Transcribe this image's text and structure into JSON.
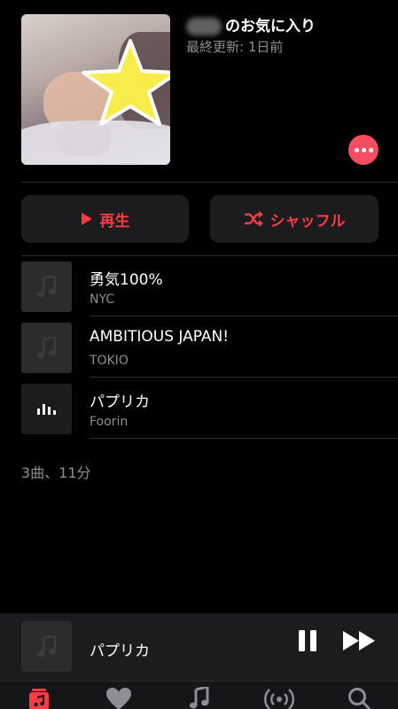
{
  "playlist": {
    "title_suffix": "のお気に入り",
    "updated": "最終更新: 1日前"
  },
  "actions": {
    "play_label": "再生",
    "shuffle_label": "シャッフル"
  },
  "songs": [
    {
      "title": "勇気100%",
      "artist": "NYC",
      "playing": false
    },
    {
      "title": "AMBITIOUS JAPAN!",
      "artist": "TOKIO",
      "playing": false
    },
    {
      "title": "パプリカ",
      "artist": "Foorin",
      "playing": true
    }
  ],
  "summary": "3曲、11分",
  "now_playing": {
    "title": "パプリカ"
  },
  "tabs": [
    {
      "icon": "library-icon",
      "active": true
    },
    {
      "icon": "heart-icon",
      "active": false
    },
    {
      "icon": "music-note-icon",
      "active": false
    },
    {
      "icon": "radio-icon",
      "active": false
    },
    {
      "icon": "search-icon",
      "active": false
    }
  ],
  "colors": {
    "accent": "#fc3c44",
    "background": "#000000",
    "secondary_text": "#8e8e93"
  }
}
